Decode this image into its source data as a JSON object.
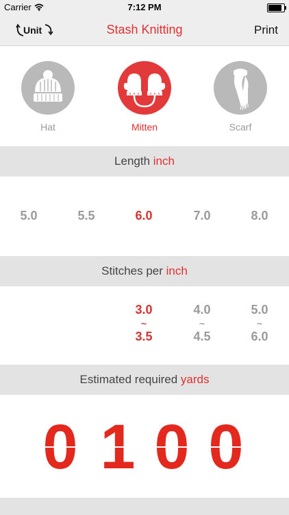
{
  "status_bar": {
    "carrier": "Carrier",
    "time": "7:12 PM",
    "battery_level": 0.95
  },
  "nav": {
    "unit_label": "Unit",
    "title": "Stash Knitting",
    "print_label": "Print"
  },
  "types": [
    {
      "label": "Hat",
      "icon": "hat-icon",
      "active": false
    },
    {
      "label": "Mitten",
      "icon": "mitten-icon",
      "active": true
    },
    {
      "label": "Scarf",
      "icon": "scarf-icon",
      "active": false
    }
  ],
  "length": {
    "prefix": "Length ",
    "unit": "inch",
    "values": [
      "5.0",
      "5.5",
      "6.0",
      "7.0",
      "8.0"
    ],
    "selected": "6.0"
  },
  "stitches": {
    "prefix": "Stitches per ",
    "unit": "inch",
    "ranges": [
      {
        "from": "3.0",
        "tilde": "~",
        "to": "3.5",
        "active": true
      },
      {
        "from": "4.0",
        "tilde": "~",
        "to": "4.5",
        "active": false
      },
      {
        "from": "5.0",
        "tilde": "~",
        "to": "6.0",
        "active": false
      }
    ]
  },
  "yards": {
    "prefix": "Estimated required ",
    "unit": "yards",
    "digits": [
      "0",
      "1",
      "0",
      "0"
    ]
  },
  "colors": {
    "accent": "#e03030",
    "counter": "#e3281e",
    "inactive": "#9a9a9a"
  }
}
